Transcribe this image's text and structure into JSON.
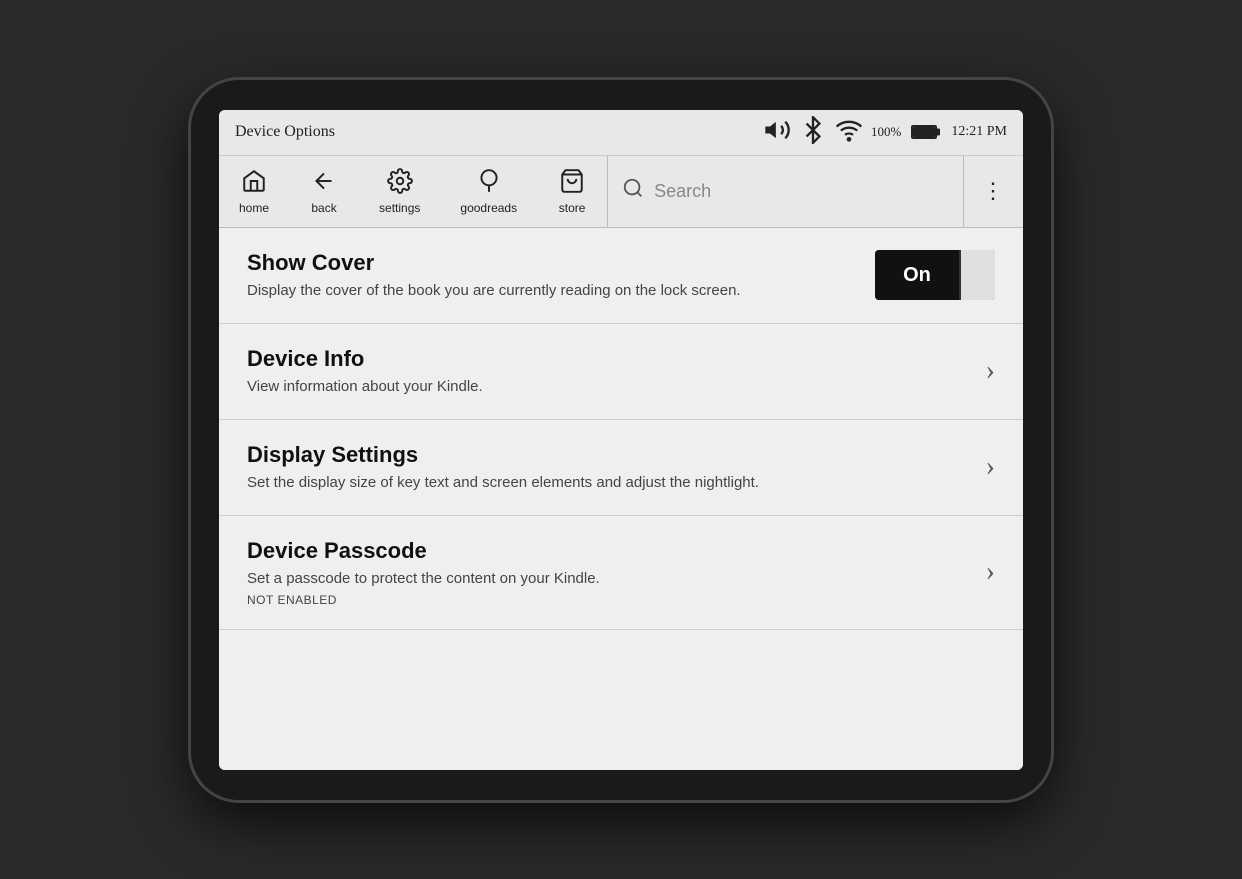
{
  "status_bar": {
    "title": "Device Options",
    "battery_percent": "100%",
    "time": "12:21 PM"
  },
  "navbar": {
    "items": [
      {
        "id": "home",
        "label": "home",
        "icon": "home"
      },
      {
        "id": "back",
        "label": "back",
        "icon": "back"
      },
      {
        "id": "settings",
        "label": "settings",
        "icon": "settings"
      },
      {
        "id": "goodreads",
        "label": "goodreads",
        "icon": "goodreads"
      },
      {
        "id": "store",
        "label": "store",
        "icon": "store"
      }
    ],
    "search_placeholder": "Search",
    "more_icon": "⋮"
  },
  "menu": {
    "items": [
      {
        "id": "show-cover",
        "title": "Show Cover",
        "description": "Display the cover of the book you are currently reading on the lock screen.",
        "control": "toggle",
        "toggle_state": "On",
        "sub_label": null
      },
      {
        "id": "device-info",
        "title": "Device Info",
        "description": "View information about your Kindle.",
        "control": "chevron",
        "sub_label": null
      },
      {
        "id": "display-settings",
        "title": "Display Settings",
        "description": "Set the display size of key text and screen elements and adjust the nightlight.",
        "control": "chevron",
        "sub_label": null
      },
      {
        "id": "device-passcode",
        "title": "Device Passcode",
        "description": "Set a passcode to protect the content on your Kindle.",
        "control": "chevron",
        "sub_label": "NOT ENABLED"
      }
    ]
  }
}
